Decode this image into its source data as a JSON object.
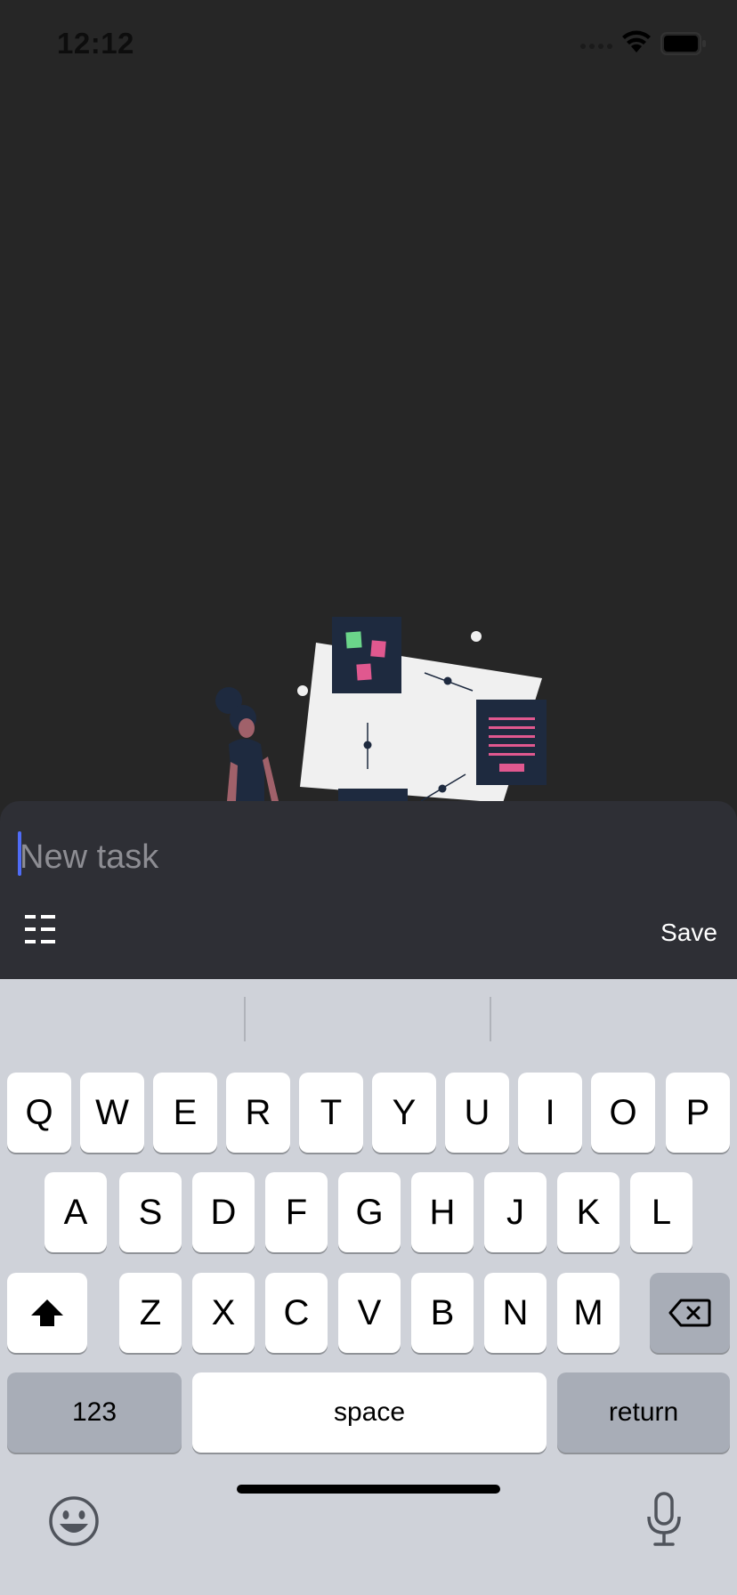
{
  "status_bar": {
    "time": "12:12"
  },
  "task_sheet": {
    "input": {
      "value": "",
      "placeholder": "New task"
    },
    "list_icon": "checklist-icon",
    "save_label": "Save"
  },
  "keyboard": {
    "row1": [
      "Q",
      "W",
      "E",
      "R",
      "T",
      "Y",
      "U",
      "I",
      "O",
      "P"
    ],
    "row2": [
      "A",
      "S",
      "D",
      "F",
      "G",
      "H",
      "J",
      "K",
      "L"
    ],
    "row3": [
      "Z",
      "X",
      "C",
      "V",
      "B",
      "N",
      "M"
    ],
    "numbers_label": "123",
    "space_label": "space",
    "return_label": "return"
  },
  "colors": {
    "accent": "#4f6cf7",
    "pink": "#e0588f",
    "green": "#6bd58a",
    "navy": "#1e2a3f"
  }
}
